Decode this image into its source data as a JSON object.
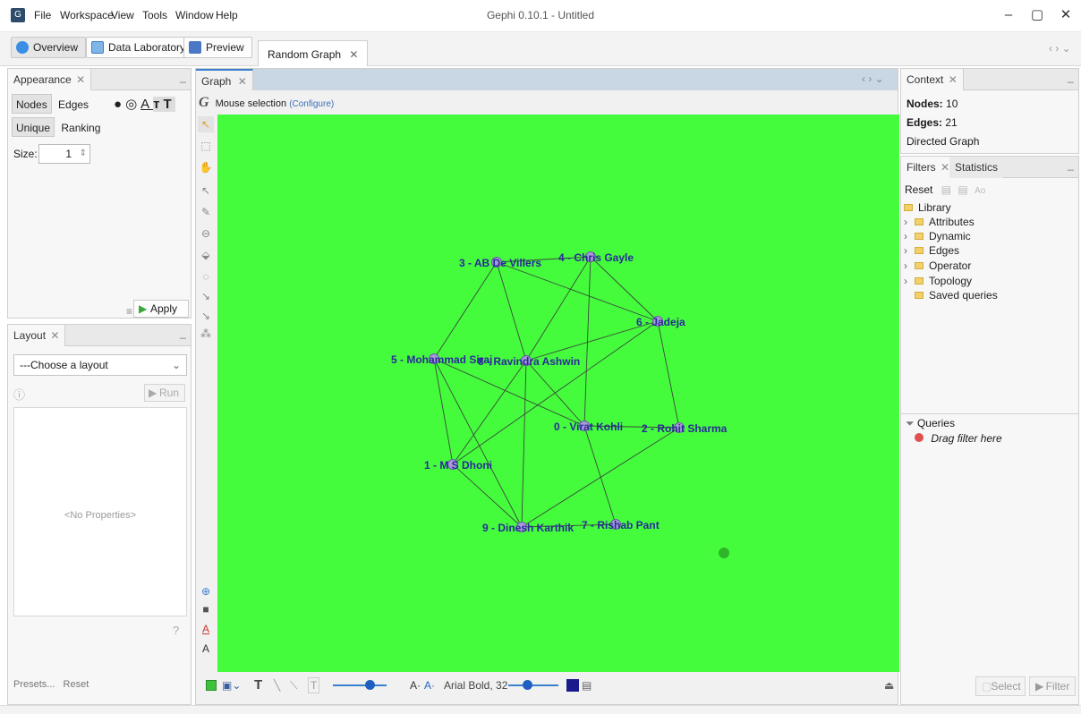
{
  "window": {
    "title": "Gephi 0.10.1 - Untitled",
    "menu": [
      "File",
      "Workspace",
      "View",
      "Tools",
      "Window",
      "Help"
    ],
    "controls": [
      "–",
      "▢",
      "✕"
    ]
  },
  "toolbar": {
    "modes": [
      "Overview",
      "Data Laboratory",
      "Preview"
    ],
    "document_tab": "Random Graph",
    "nav_arrows": "‹ › ⌄"
  },
  "appearance": {
    "tab": "Appearance",
    "subtabs": [
      "Nodes",
      "Edges"
    ],
    "mode_tabs": [
      "Unique",
      "Ranking"
    ],
    "size_label": "Size:",
    "size_value": "1",
    "apply_label": "Apply"
  },
  "layout_panel": {
    "tab": "Layout",
    "select_value": "---Choose a layout",
    "run_label": "Run",
    "no_properties": "<No Properties>",
    "presets_label": "Presets...",
    "reset_label": "Reset"
  },
  "graph_panel": {
    "tab": "Graph",
    "mouse_selection": "Mouse selection",
    "configure": "(Configure)",
    "font_label": "Arial Bold, 32",
    "nodes": [
      {
        "id": "0",
        "label": "0 - Virat Kohli"
      },
      {
        "id": "1",
        "label": "1 - M S Dhoni"
      },
      {
        "id": "2",
        "label": "2 - Rohit Sharma"
      },
      {
        "id": "3",
        "label": "3 - AB De Villers"
      },
      {
        "id": "4",
        "label": "4 - Chris Gayle"
      },
      {
        "id": "5",
        "label": "5 - Mohammad Siraj"
      },
      {
        "id": "6",
        "label": "6 - Jadeja"
      },
      {
        "id": "7",
        "label": "7 - Rishab Pant"
      },
      {
        "id": "8",
        "label": "8 - Ravindra Ashwin"
      },
      {
        "id": "9",
        "label": "9 - Dinesh Karthik"
      }
    ],
    "edges": [
      [
        "3",
        "4"
      ],
      [
        "3",
        "5"
      ],
      [
        "3",
        "8"
      ],
      [
        "3",
        "6"
      ],
      [
        "4",
        "6"
      ],
      [
        "4",
        "8"
      ],
      [
        "4",
        "0"
      ],
      [
        "5",
        "1"
      ],
      [
        "5",
        "0"
      ],
      [
        "5",
        "9"
      ],
      [
        "8",
        "6"
      ],
      [
        "8",
        "9"
      ],
      [
        "8",
        "0"
      ],
      [
        "6",
        "1"
      ],
      [
        "6",
        "2"
      ],
      [
        "0",
        "2"
      ],
      [
        "0",
        "7"
      ],
      [
        "2",
        "9"
      ],
      [
        "1",
        "9"
      ],
      [
        "9",
        "7"
      ],
      [
        "1",
        "8"
      ]
    ]
  },
  "context": {
    "tab": "Context",
    "nodes_label": "Nodes:",
    "nodes_value": "10",
    "edges_label": "Edges:",
    "edges_value": "21",
    "graph_type": "Directed Graph"
  },
  "filters": {
    "tabs": [
      "Filters",
      "Statistics"
    ],
    "reset_label": "Reset",
    "library": "Library",
    "items": [
      "Attributes",
      "Dynamic",
      "Edges",
      "Operator",
      "Topology"
    ],
    "saved_queries": "Saved queries",
    "queries_label": "Queries",
    "drag_hint": "Drag filter here",
    "select_label": "Select",
    "filter_label": "Filter"
  },
  "colors": {
    "graph_background": "#44fc3c",
    "node_fill": "#a89ad8",
    "label_color": "#2a2a9a"
  }
}
